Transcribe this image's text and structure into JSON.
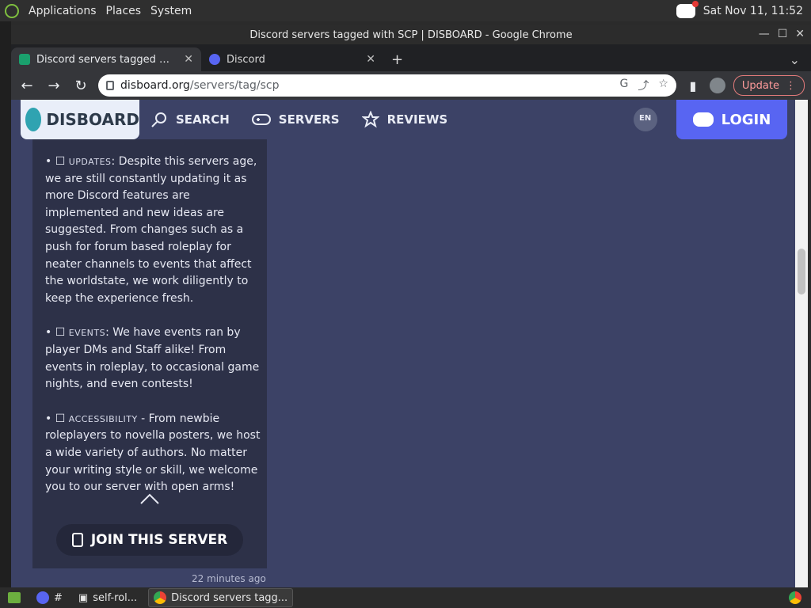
{
  "top_panel": {
    "menu": [
      "Applications",
      "Places",
      "System"
    ],
    "clock": "Sat Nov 11, 11:52"
  },
  "window": {
    "title": "Discord servers tagged with SCP | DISBOARD - Google Chrome"
  },
  "tabs": [
    {
      "title": "Discord servers tagged with SC",
      "active": true
    },
    {
      "title": "Discord",
      "active": false
    }
  ],
  "toolbar": {
    "url_domain": "disboard.org",
    "url_path": "/servers/tag/scp",
    "update_label": "Update"
  },
  "disboard": {
    "logo_text": "DISBOARD",
    "nav": [
      {
        "label": "SEARCH",
        "icon": "search-icon"
      },
      {
        "label": "SERVERS",
        "icon": "gamepad-icon"
      },
      {
        "label": "REVIEWS",
        "icon": "star-icon"
      }
    ],
    "language_badge": "EN",
    "login_label": "LOGIN"
  },
  "card": {
    "paragraphs": [
      {
        "heading": "UPDATES",
        "sep": ": ",
        "text": "Despite this servers age, we are still constantly updating it as more Discord features are implemented and new ideas are suggested. From changes such as a push for forum based roleplay for neater channels to events that affect the worldstate, we work diligently to keep the experience fresh."
      },
      {
        "heading": "EVENTS",
        "sep": ": ",
        "text": "We have events ran by player DMs and Staff alike! From events in roleplay, to occasional game nights, and even contests!"
      },
      {
        "heading": "ACCESSIBILITY",
        "sep": " - ",
        "text": "From newbie roleplayers to novella posters, we host a wide variety of authors. No matter your writing style or skill, we welcome you to our server with open arms!"
      }
    ],
    "join_label": "JOIN THIS SERVER",
    "timestamp": "22 minutes ago"
  },
  "taskbar": {
    "items": [
      {
        "label": "#",
        "icon": "hash-icon"
      },
      {
        "label": "self-rol...",
        "icon": "window-icon"
      },
      {
        "label": "Discord servers tagg...",
        "icon": "chrome-icon"
      }
    ]
  }
}
